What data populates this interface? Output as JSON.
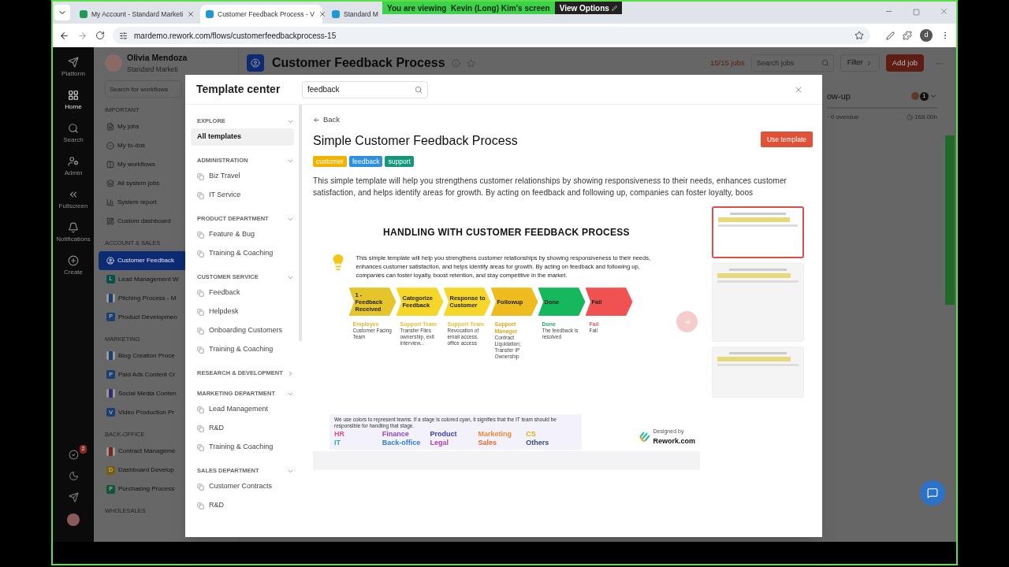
{
  "browser": {
    "tabs": [
      {
        "title": "My Account - Standard Marketi",
        "selected": false,
        "color": "#1e9a55"
      },
      {
        "title": "Customer Feedback Process - V",
        "selected": true,
        "color": "#1b9ad6"
      },
      {
        "title": "Standard M",
        "selected": false,
        "color": "#1b9ad6"
      }
    ],
    "url": "mardemo.rework.com/flows/customerfeedbackprocess-15",
    "profile": "d"
  },
  "share_banner": {
    "text": "You are viewing  Kevin (Long) Kim's screen",
    "button": "View Options"
  },
  "rail": {
    "items": [
      {
        "label": "Platform",
        "selected": false
      },
      {
        "label": "Home",
        "selected": true
      },
      {
        "label": "Search",
        "selected": false
      },
      {
        "label": "Admin",
        "selected": false
      },
      {
        "label": "Fullscreen",
        "selected": false
      },
      {
        "label": "Notifications",
        "selected": false
      },
      {
        "label": "Create",
        "selected": false
      }
    ],
    "badge": "2"
  },
  "sidebar": {
    "user": "Olivia Mendoza",
    "org": "Standard Marketi",
    "search_placeholder": "Search for workflows",
    "sections": [
      {
        "title": "IMPORTANT",
        "items": [
          {
            "label": "My jobs",
            "kind": "icon",
            "selected": false
          },
          {
            "label": "My to-dos",
            "kind": "icon",
            "selected": false
          },
          {
            "label": "My workflows",
            "kind": "icon",
            "selected": false
          },
          {
            "label": "All system jobs",
            "kind": "icon",
            "selected": false
          },
          {
            "label": "System report",
            "kind": "icon",
            "selected": false
          },
          {
            "label": "Custom dashboard",
            "kind": "icon",
            "selected": false
          }
        ]
      },
      {
        "title": "ACCOUNT & SALES",
        "items": [
          {
            "label": "Customer Feedback",
            "kind": "person",
            "selected": true
          },
          {
            "label": "Lead Management W",
            "kind": "letter",
            "badge": "L",
            "color": "#0b4f46",
            "selected": false
          },
          {
            "label": "Pitching Process - M",
            "kind": "board",
            "color": "#1b3f6e",
            "selected": false
          },
          {
            "label": "Product Developmen",
            "kind": "letter",
            "badge": "P",
            "color": "#1b3f6e",
            "selected": false
          }
        ]
      },
      {
        "title": "MARKETING",
        "items": [
          {
            "label": "Blog Creation Proce",
            "kind": "board",
            "color": "#1b3f6e",
            "selected": false
          },
          {
            "label": "Paid Ads Content Cr",
            "kind": "letter",
            "badge": "P",
            "color": "#1b3f6e",
            "selected": false
          },
          {
            "label": "Social Media Conten",
            "kind": "board",
            "color": "#342c70",
            "selected": false
          },
          {
            "label": "Video Production Pr",
            "kind": "letter",
            "badge": "V",
            "color": "#1b3f6e",
            "selected": false
          }
        ]
      },
      {
        "title": "BACK-OFFICE",
        "items": [
          {
            "label": "Contract Manageme",
            "kind": "board",
            "color": "#74271b",
            "selected": false
          },
          {
            "label": "Dashboard Develop",
            "kind": "letter",
            "badge": "D",
            "color": "#7a5d0c",
            "selected": false
          },
          {
            "label": "Purchasing Process",
            "kind": "letter",
            "badge": "P",
            "color": "#115438",
            "selected": false
          }
        ]
      },
      {
        "title": "WHOLESALES"
      }
    ]
  },
  "header": {
    "title": "Customer Feedback Process",
    "jobs": "15/15 jobs",
    "search_placeholder": "Search jobs",
    "filter": "Filter",
    "add": "Add job"
  },
  "column": {
    "title": "ow-up",
    "count": "1",
    "overdue": "· 0 overdue",
    "hours": "168.00h"
  },
  "modal": {
    "title": "Template center",
    "search": "feedback",
    "nav": [
      {
        "title": "EXPLORE",
        "expanded": true,
        "items": [
          {
            "label": "All templates",
            "selected": true
          }
        ]
      },
      {
        "title": "ADMINISTRATION",
        "expanded": true,
        "items": [
          {
            "label": "Biz Travel",
            "selected": false
          },
          {
            "label": "IT Service",
            "selected": false
          }
        ]
      },
      {
        "title": "PRODUCT DEPARTMENT",
        "expanded": true,
        "items": [
          {
            "label": "Feature & Bug",
            "selected": false
          },
          {
            "label": "Training & Coaching",
            "selected": false
          }
        ]
      },
      {
        "title": "CUSTOMER SERVICE",
        "expanded": true,
        "items": [
          {
            "label": "Feedback",
            "selected": false
          },
          {
            "label": "Helpdesk",
            "selected": false
          },
          {
            "label": "Onboarding Customers",
            "selected": false
          },
          {
            "label": "Training & Coaching",
            "selected": false
          }
        ]
      },
      {
        "title": "RESEARCH & DEVELOPMENT",
        "expanded": false
      },
      {
        "title": "MARKETING DEPARTMENT",
        "expanded": true,
        "items": [
          {
            "label": "Lead Management",
            "selected": false
          },
          {
            "label": "R&D",
            "selected": false
          },
          {
            "label": "Training & Coaching",
            "selected": false
          }
        ]
      },
      {
        "title": "SALES DEPARTMENT",
        "expanded": true,
        "items": [
          {
            "label": "Customer Contracts",
            "selected": false
          },
          {
            "label": "R&D",
            "selected": false
          }
        ]
      }
    ],
    "back": "Back",
    "template": {
      "title": "Simple Customer Feedback Process",
      "button": "Use template",
      "tags": [
        {
          "label": "customer",
          "color": "#f0b400"
        },
        {
          "label": "feedback",
          "color": "#2d8fe0"
        },
        {
          "label": "support",
          "color": "#17967e"
        }
      ],
      "description": "This simple template will help you strengthens customer relationships by showing responsiveness to their needs, enhances customer satisfaction, and helps identify areas for growth. By acting on feedback and following up, companies can foster loyalty, boos"
    },
    "preview": {
      "heading": "HANDLING WITH CUSTOMER FEEDBACK PROCESS",
      "intro": "This simple template will help you strengthens customer relationships by showing responsiveness to their needs, enhances customer satisfaction, and helps identify areas for growth. By acting on feedback and following up, companies can foster loyalty, boost retention, and stay competitive in the market.",
      "stages": [
        {
          "title": "1 - Feedback Received",
          "color": "#e6c52c",
          "team": {
            "label": "Employee",
            "color": "#d9b83a"
          },
          "note": "Customer Facing Team"
        },
        {
          "title": "Categorize Feedback",
          "color": "#f7d62a",
          "team": {
            "label": "Support Team",
            "color": "#e0c23a"
          },
          "note": "Transfer Files ownership, exit interview..."
        },
        {
          "title": "Response to Customer",
          "color": "#f7d62a",
          "team": {
            "label": "Support Team",
            "color": "#e0c23a"
          },
          "note": "Revocation of email access, office access"
        },
        {
          "title": "Followup",
          "color": "#eebc1e",
          "team": {
            "label": "Support Manager",
            "color": "#d9aa20"
          },
          "note": "Contract Liquidation; Transfer IP Ownership"
        },
        {
          "title": "Done",
          "color": "#15b85c",
          "team": {
            "label": "Done",
            "color": "#2aa878"
          },
          "note": "The feedback is resolved"
        },
        {
          "title": "Fail",
          "color": "#f05252",
          "team": {
            "label": "Fail",
            "color": "#e06a6a"
          },
          "note": "Fail"
        }
      ],
      "legend_text": "We use colors to represent teams. If a stage is colored cyan, it signifies that the IT team should be responsible for handling that stage.",
      "legend": [
        {
          "label": "HR",
          "color": "#e0508a"
        },
        {
          "label": "Finance",
          "color": "#8e44c8"
        },
        {
          "label": "Product",
          "color": "#3b3bb0"
        },
        {
          "label": "Marketing",
          "color": "#e88a3a"
        },
        {
          "label": "CS",
          "color": "#d4b020"
        },
        {
          "label": "IT",
          "color": "#2aa8c4"
        },
        {
          "label": "Back-office",
          "color": "#2f7fd0"
        },
        {
          "label": "Legal",
          "color": "#b040b0"
        },
        {
          "label": "Sales",
          "color": "#e06a30"
        },
        {
          "label": "Others",
          "color": "#3b4a70"
        }
      ],
      "designed_by": "Designed by",
      "brand": "Rework.com"
    },
    "thumbnails": [
      {
        "selected": true
      },
      {
        "selected": false
      },
      {
        "selected": false
      }
    ]
  }
}
